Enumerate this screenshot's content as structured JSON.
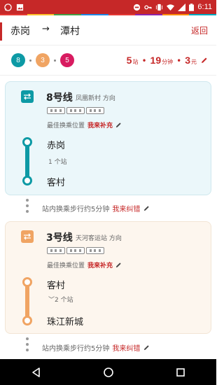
{
  "status_bar": {
    "time": "6:11",
    "icons": [
      "whatsapp-icon",
      "image-icon",
      "blocked-icon",
      "key-icon",
      "vibrate-icon",
      "wifi-icon",
      "signal-icon",
      "battery-icon"
    ]
  },
  "color_strip": [
    "#e53935",
    "#fbc02d",
    "#43a047",
    "#1e88e5",
    "#e53935",
    "#8e24aa",
    "#fb8c00",
    "#00acc1"
  ],
  "header": {
    "from": "赤岗",
    "arrow": "→",
    "to": "潭村",
    "back_label": "返回"
  },
  "summary": {
    "lines": [
      {
        "label": "8",
        "color": "#0d9aa5"
      },
      {
        "label": "3",
        "color": "#f0a463"
      },
      {
        "label": "5",
        "color": "#d81b60"
      }
    ],
    "stops": "5",
    "stops_unit": "站",
    "minutes": "19",
    "minutes_unit": "分钟",
    "price": "3",
    "price_unit": "元",
    "sep": "•"
  },
  "segments": [
    {
      "line": "8号线",
      "direction": "凤凰新村 方向",
      "color": "#0d9aa5",
      "best_position_label": "最佳换乘位置",
      "contribute_link": "我来补充",
      "board_station": "赤岗",
      "stop_count": "1 个站",
      "alight_station": "客村"
    },
    {
      "line": "3号线",
      "direction": "天河客运站 方向",
      "color": "#f0a463",
      "best_position_label": "最佳换乘位置",
      "contribute_link": "我来补充",
      "board_station": "客村",
      "stop_count": "﹀2 个站",
      "alight_station": "珠江新城"
    }
  ],
  "transfers": [
    {
      "text": "站内换乘步行约5分钟",
      "link": "我来纠错"
    },
    {
      "text": "站内换乘步行约5分钟",
      "link": "我来纠错"
    }
  ]
}
